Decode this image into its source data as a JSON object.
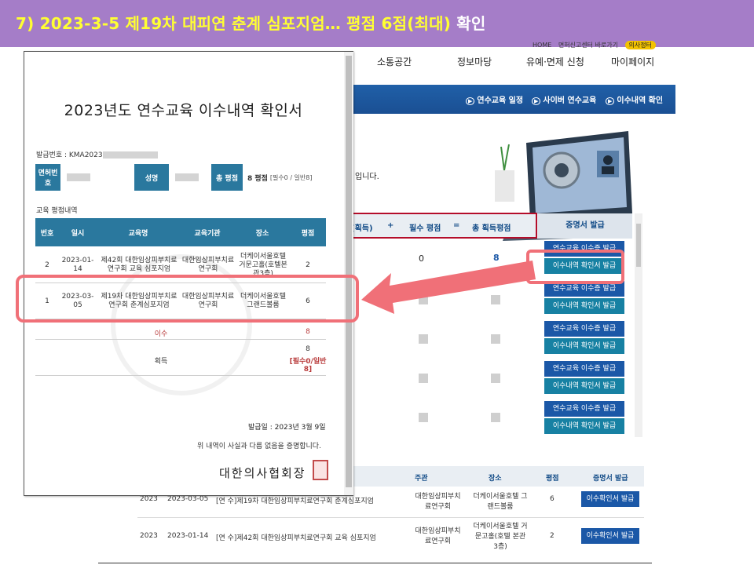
{
  "banner": {
    "title": "7) 2023-3-5 제19차 대피연 춘계 심포지엄…  평점 6점(최대) ",
    "suffix": "확인"
  },
  "site": {
    "top_links": [
      "HOME",
      "면허신고센터 바로가기",
      "의사정터"
    ],
    "menu": [
      "소통공간",
      "정보마당",
      "유예·면제 신청",
      "마이페이지"
    ],
    "bluebar_links": [
      "연수교육 일정",
      "사이버 연수교육",
      "이수내역 확인"
    ],
    "intro_tail": "입니다.",
    "summary_header": [
      "(획득)",
      "+",
      "필수 평점",
      "=",
      "총 획득평점"
    ],
    "cert_header": "증명서 발급",
    "summary_values": {
      "required": "0",
      "total": "8"
    },
    "btn_cert": "연수교육 이수증 발급",
    "btn_history": "이수내역 확인서 발급",
    "history_header": [
      "주관",
      "장소",
      "평점",
      "증명서 발급"
    ],
    "history_rows": [
      {
        "year": "2023",
        "date": "2023-03-05",
        "title": "[연 수]제19차 대한임상피부치료연구회 춘계심포지엄",
        "org": "대한임상피부치료연구회",
        "place": "더케이서울호텔 그랜드볼룸",
        "score": "6",
        "btn": "이수확인서 발급"
      },
      {
        "year": "2023",
        "date": "2023-01-14",
        "title": "[연 수]제42회 대한임상피부치료연구회 교육 심포지엄",
        "org": "대한임상피부치료연구회",
        "place": "더케이서울호텔 거문고홀(호텔 본관3층)",
        "score": "2",
        "btn": "이수확인서 발급"
      }
    ]
  },
  "doc": {
    "title": "2023년도 연수교육 이수내역 확인서",
    "issue_no_label": "발급번호 : KMA2023",
    "info": {
      "license_label": "면허번호",
      "name_label": "성명",
      "total_label": "총 평점",
      "total_value": "8 평점",
      "total_detail": "[필수0 / 일반8]"
    },
    "section_label": "교육 평점내역",
    "headers": [
      "번호",
      "일시",
      "교육명",
      "교육기관",
      "장소",
      "평점"
    ],
    "rows": [
      {
        "no": "2",
        "date": "2023-01-14",
        "name": "제42회 대한임상피부치료연구회 교육 심포지엄",
        "org": "대한임상피부치료연구회",
        "place": "더케이서울호텔 거문고홀(호텔본관3층)",
        "score": "2"
      },
      {
        "no": "1",
        "date": "2023-03-05",
        "name": "제19차 대한임상피부치료연구회 춘계심포지엄",
        "org": "대한임상피부치료연구회",
        "place": "더케이서울호텔 그랜드볼룸",
        "score": "6"
      }
    ],
    "isu_label": "이수",
    "isu_value": "8",
    "gain_label": "획득",
    "gain_value": "8",
    "gain_detail": "[필수0/일반8]",
    "issue_date": "발급일 : 2023년 3월 9일",
    "confirm_text": "위 내역이 사실과 다름 없음을 증명합니다.",
    "signature": "대한의사협회장"
  },
  "colors": {
    "banner_bg": "#a57dc8",
    "banner_text": "#ffff33",
    "table_header": "#2a789e",
    "highlight": "#f07078",
    "site_blue": "#1b58a7"
  }
}
